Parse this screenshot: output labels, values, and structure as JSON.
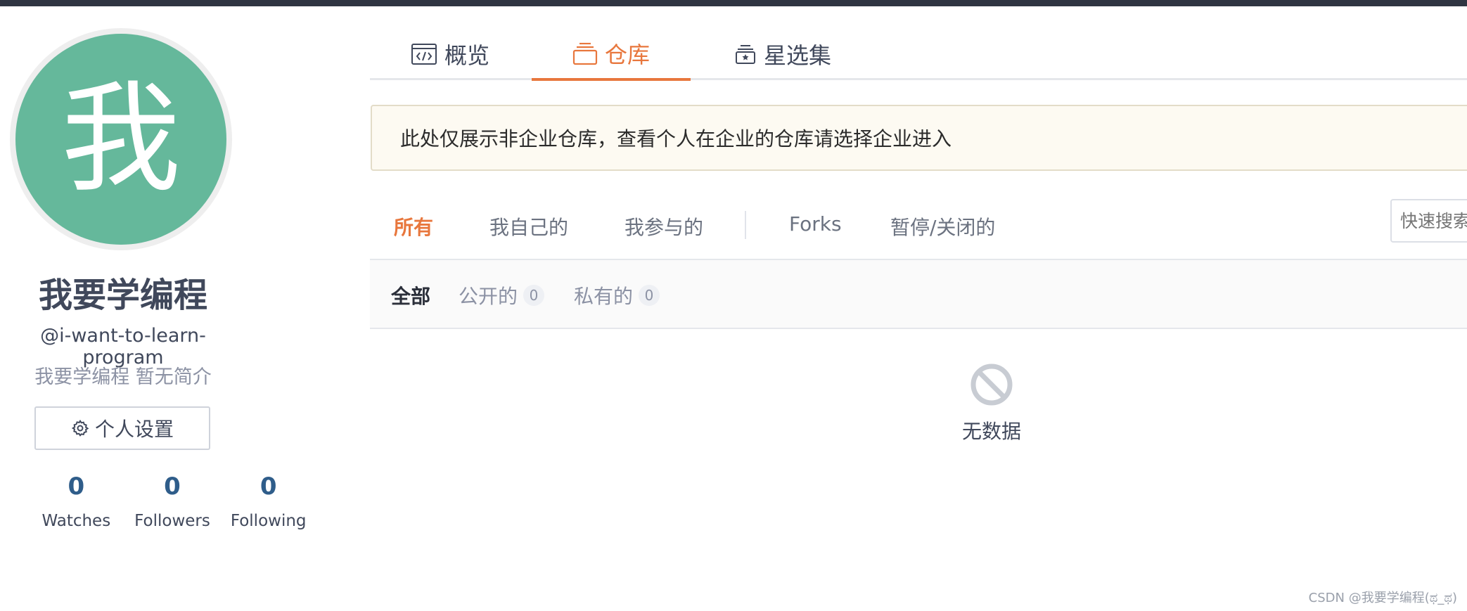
{
  "profile": {
    "avatar_char": "我",
    "name": "我要学编程",
    "handle": "@i-want-to-learn-program",
    "bio": "我要学编程 暂无简介",
    "settings_label": "个人设置",
    "stats": [
      {
        "count": "0",
        "label": "Watches"
      },
      {
        "count": "0",
        "label": "Followers"
      },
      {
        "count": "0",
        "label": "Following"
      }
    ]
  },
  "main_tabs": [
    {
      "label": "概览",
      "icon": "code-window-icon"
    },
    {
      "label": "仓库",
      "icon": "repository-icon",
      "active": true
    },
    {
      "label": "星选集",
      "icon": "star-collection-icon"
    }
  ],
  "notice": "此处仅展示非企业仓库，查看个人在企业的仓库请选择企业进入",
  "filter_tabs": [
    {
      "label": "所有",
      "active": true
    },
    {
      "label": "我自己的"
    },
    {
      "label": "我参与的"
    },
    {
      "label": "Forks"
    },
    {
      "label": "暂停/关闭的"
    }
  ],
  "search": {
    "placeholder": "快速搜索"
  },
  "sub_tabs": [
    {
      "label": "全部",
      "active": true
    },
    {
      "label": "公开的",
      "count": "0"
    },
    {
      "label": "私有的",
      "count": "0"
    }
  ],
  "empty": {
    "text": "无数据",
    "icon": "no-data-icon"
  },
  "watermark": "CSDN @我要学编程(ಥ_ಥ)",
  "colors": {
    "accent": "#e8773d",
    "avatar_bg": "#65b89b",
    "stat_number": "#2f5d8a",
    "top_bar": "#2f3542"
  }
}
